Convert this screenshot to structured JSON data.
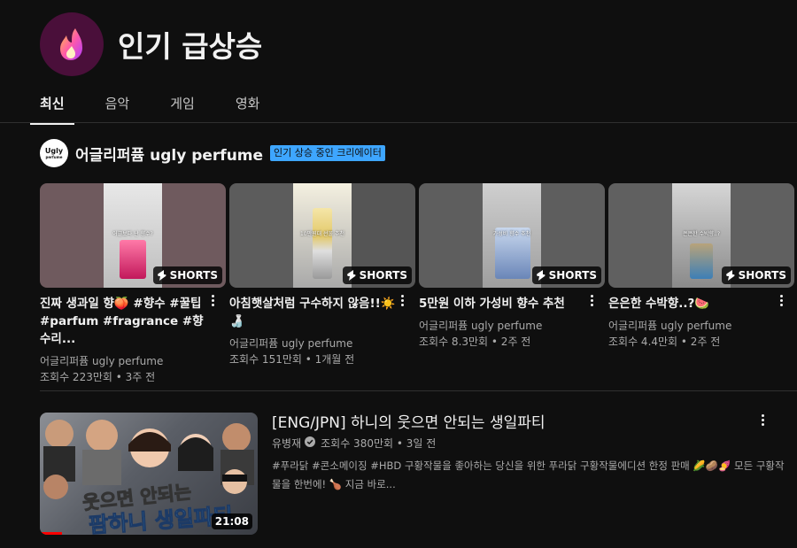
{
  "header": {
    "title": "인기 급상승"
  },
  "tabs": [
    {
      "label": "최신",
      "active": true
    },
    {
      "label": "음악"
    },
    {
      "label": "게임"
    },
    {
      "label": "영화"
    }
  ],
  "shelf": {
    "avatar_text": "Ugly",
    "avatar_sub": "perfume",
    "channel": "어글리퍼퓸 ugly perfume",
    "badge": "인기 상승 중인 크리에이터",
    "badge_color": "#3ea6ff",
    "shorts_label": "SHORTS",
    "items": [
      {
        "title": "진짜 생과일 향🍑 #향수 #꿀팁 #parfum #fragrance #향수리...",
        "channel": "어글리퍼퓸 ugly perfume",
        "meta": "조회수 223만회 • 3주 전",
        "caption": "어글보다 난 향수?"
      },
      {
        "title": "아침햇살처럼 구수하지 않음!!☀️🍶",
        "channel": "어글리퍼퓸 ugly perfume",
        "meta": "조회수 151만회 • 1개월 전",
        "caption": "10만원대 선물 추천"
      },
      {
        "title": "5만원 이하 가성비 향수 추천",
        "channel": "어글리퍼퓸 ugly perfume",
        "meta": "조회수 8.3만회 • 2주 전",
        "caption": "가성비 향수 추천"
      },
      {
        "title": "은은한 수박향..?🍉",
        "channel": "어글리퍼퓸 ugly perfume",
        "meta": "조회수 4.4만회 • 2주 전",
        "caption": "은은한 수박향..?"
      }
    ]
  },
  "video": {
    "title": "[ENG/JPN] 하니의 웃으면 안되는 생일파티",
    "channel": "유병재",
    "meta": "조회수 380만회 • 3일 전",
    "description": "#푸라닭 #콘소메이징 #HBD 구황작물을 좋아하는 당신을 위한 푸라닭 구황작물에디션 한정 판매 🌽🥔🍠 모든 구황작물을 한번에! 🍗 지금 바로...",
    "duration": "21:08",
    "thumb_text1": "웃으면 안되는",
    "thumb_text2": "팜하니 생일파티",
    "watch_progress": 0.1
  },
  "colors": {
    "background": "#0f0f0f",
    "accent": "#ff0000"
  }
}
